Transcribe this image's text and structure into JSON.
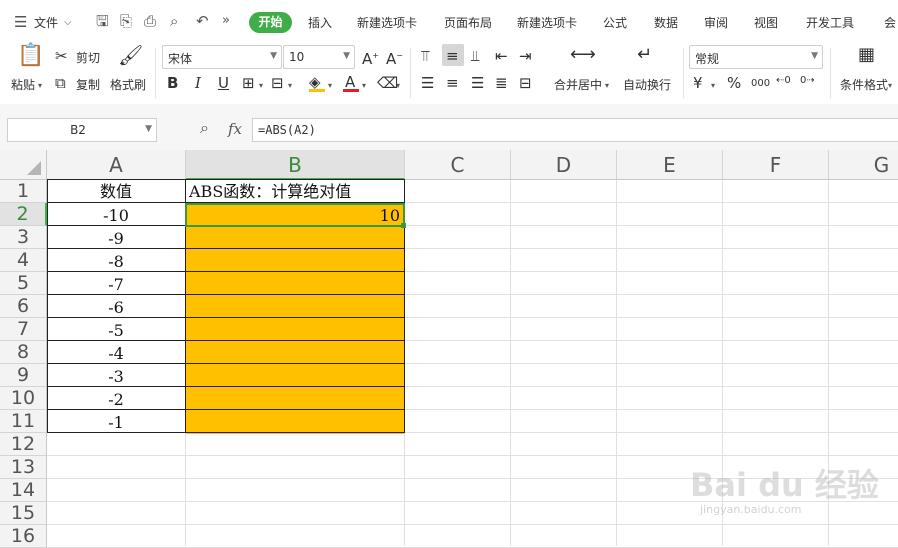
{
  "menu": {
    "file": "文件",
    "tabs": [
      "开始",
      "插入",
      "新建选项卡",
      "页面布局",
      "新建选项卡",
      "公式",
      "数据",
      "审阅",
      "视图",
      "开发工具",
      "会"
    ]
  },
  "ribbon": {
    "paste": "粘贴",
    "cut": "剪切",
    "copy": "复制",
    "format_painter": "格式刷",
    "font_name": "宋体",
    "font_size": "10",
    "bold": "B",
    "italic": "I",
    "underline": "U",
    "merge_center": "合并居中",
    "wrap_text": "自动换行",
    "number_format": "常规",
    "currency": "¥",
    "percent": "%",
    "thousands": "000",
    "conditional_format": "条件格式"
  },
  "formula_bar": {
    "name_box": "B2",
    "fx": "fx",
    "formula": "=ABS(A2)"
  },
  "columns": [
    "A",
    "B",
    "C",
    "D",
    "E",
    "F",
    "G"
  ],
  "rows": [
    "1",
    "2",
    "3",
    "4",
    "5",
    "6",
    "7",
    "8",
    "9",
    "10",
    "11",
    "12",
    "13",
    "14",
    "15",
    "16"
  ],
  "cells": {
    "A1": "数值",
    "B1": "ABS函数：计算绝对值",
    "A2": "-10",
    "A3": "-9",
    "A4": "-8",
    "A5": "-7",
    "A6": "-6",
    "A7": "-5",
    "A8": "-4",
    "A9": "-3",
    "A10": "-2",
    "A11": "-1",
    "B2": "10"
  },
  "colors": {
    "accent": "#3fae49",
    "fill": "#ffc000"
  }
}
